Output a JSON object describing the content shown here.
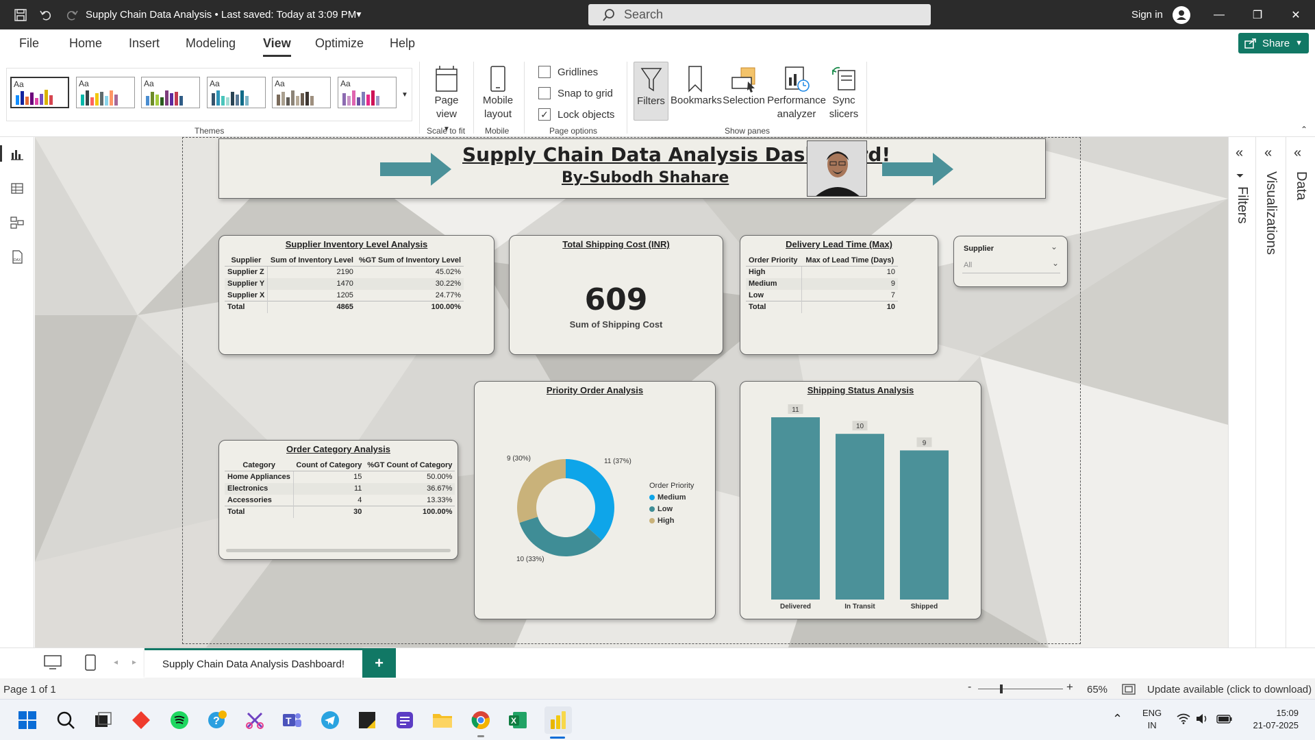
{
  "titlebar": {
    "title": "Supply Chain Data Analysis • Last saved: Today at 3:09 PM",
    "search_placeholder": "Search",
    "signin": "Sign in"
  },
  "menu": {
    "items": [
      "File",
      "Home",
      "Insert",
      "Modeling",
      "View",
      "Optimize",
      "Help"
    ],
    "active": "View",
    "share_label": "Share"
  },
  "ribbon": {
    "themes_label": "Themes",
    "theme_aa": "Aa",
    "page_view_label": "Page view",
    "scale_label": "Scale to fit",
    "mobile_layout_label": "Mobile layout",
    "mobile_group_label": "Mobile",
    "checkboxes": [
      {
        "label": "Gridlines",
        "checked": false
      },
      {
        "label": "Snap to grid",
        "checked": false
      },
      {
        "label": "Lock objects",
        "checked": true
      }
    ],
    "page_options_label": "Page options",
    "pane_buttons": [
      "Filters",
      "Bookmarks",
      "Selection",
      "Performance analyzer",
      "Sync slicers"
    ],
    "show_panes_label": "Show panes"
  },
  "dashboard": {
    "header_title": "Supply Chain Data Analysis Dashboard!",
    "header_author": "By-Subodh Shahare",
    "supplier_inventory": {
      "title": "Supplier Inventory Level Analysis",
      "columns": [
        "Supplier",
        "Sum of Inventory Level",
        "%GT Sum of Inventory Level"
      ],
      "rows": [
        [
          "Supplier Z",
          "2190",
          "45.02%"
        ],
        [
          "Supplier Y",
          "1470",
          "30.22%"
        ],
        [
          "Supplier X",
          "1205",
          "24.77%"
        ]
      ],
      "total": [
        "Total",
        "4865",
        "100.00%"
      ]
    },
    "shipping_cost": {
      "title": "Total Shipping Cost (INR)",
      "value": "609",
      "caption": "Sum of Shipping Cost"
    },
    "lead_time": {
      "title": "Delivery Lead Time (Max)",
      "columns": [
        "Order Priority",
        "Max of Lead Time (Days)"
      ],
      "rows": [
        [
          "High",
          "10"
        ],
        [
          "Medium",
          "9"
        ],
        [
          "Low",
          "7"
        ]
      ],
      "total": [
        "Total",
        "10"
      ]
    },
    "slicer": {
      "title": "Supplier",
      "value": "All"
    },
    "order_category": {
      "title": "Order Category Analysis",
      "columns": [
        "Category",
        "Count of Category",
        "%GT Count of Category"
      ],
      "rows": [
        [
          "Home Appliances",
          "15",
          "50.00%"
        ],
        [
          "Electronics",
          "11",
          "36.67%"
        ],
        [
          "Accessories",
          "4",
          "13.33%"
        ]
      ],
      "total": [
        "Total",
        "30",
        "100.00%"
      ]
    },
    "priority_chart": {
      "title": "Priority Order Analysis",
      "legend_title": "Order Priority",
      "labels": [
        "11 (37%)",
        "10 (33%)",
        "9 (30%)"
      ]
    },
    "shipping_status_chart": {
      "title": "Shipping Status Analysis"
    }
  },
  "chart_data": [
    {
      "type": "pie",
      "title": "Priority Order Analysis",
      "legend_title": "Order Priority",
      "categories": [
        "Medium",
        "Low",
        "High"
      ],
      "values": [
        11,
        10,
        9
      ],
      "colors": [
        "#0ea5e9",
        "#3f8d96",
        "#c9b27a"
      ]
    },
    {
      "type": "bar",
      "title": "Shipping Status Analysis",
      "categories": [
        "Delivered",
        "In Transit",
        "Shipped"
      ],
      "values": [
        11,
        10,
        9
      ],
      "color": "#4b9199",
      "ylim": [
        0,
        11
      ]
    }
  ],
  "pages": {
    "active_tab": "Supply Chain Data Analysis Dashboard!"
  },
  "panes": {
    "filters": "Filters",
    "visualizations": "Visualizations",
    "data": "Data"
  },
  "status": {
    "page": "Page 1 of 1",
    "zoom": "65%",
    "update": "Update available (click to download)"
  },
  "taskbar": {
    "lang": "ENG",
    "region": "IN",
    "time": "15:09",
    "date": "21-07-2025"
  }
}
